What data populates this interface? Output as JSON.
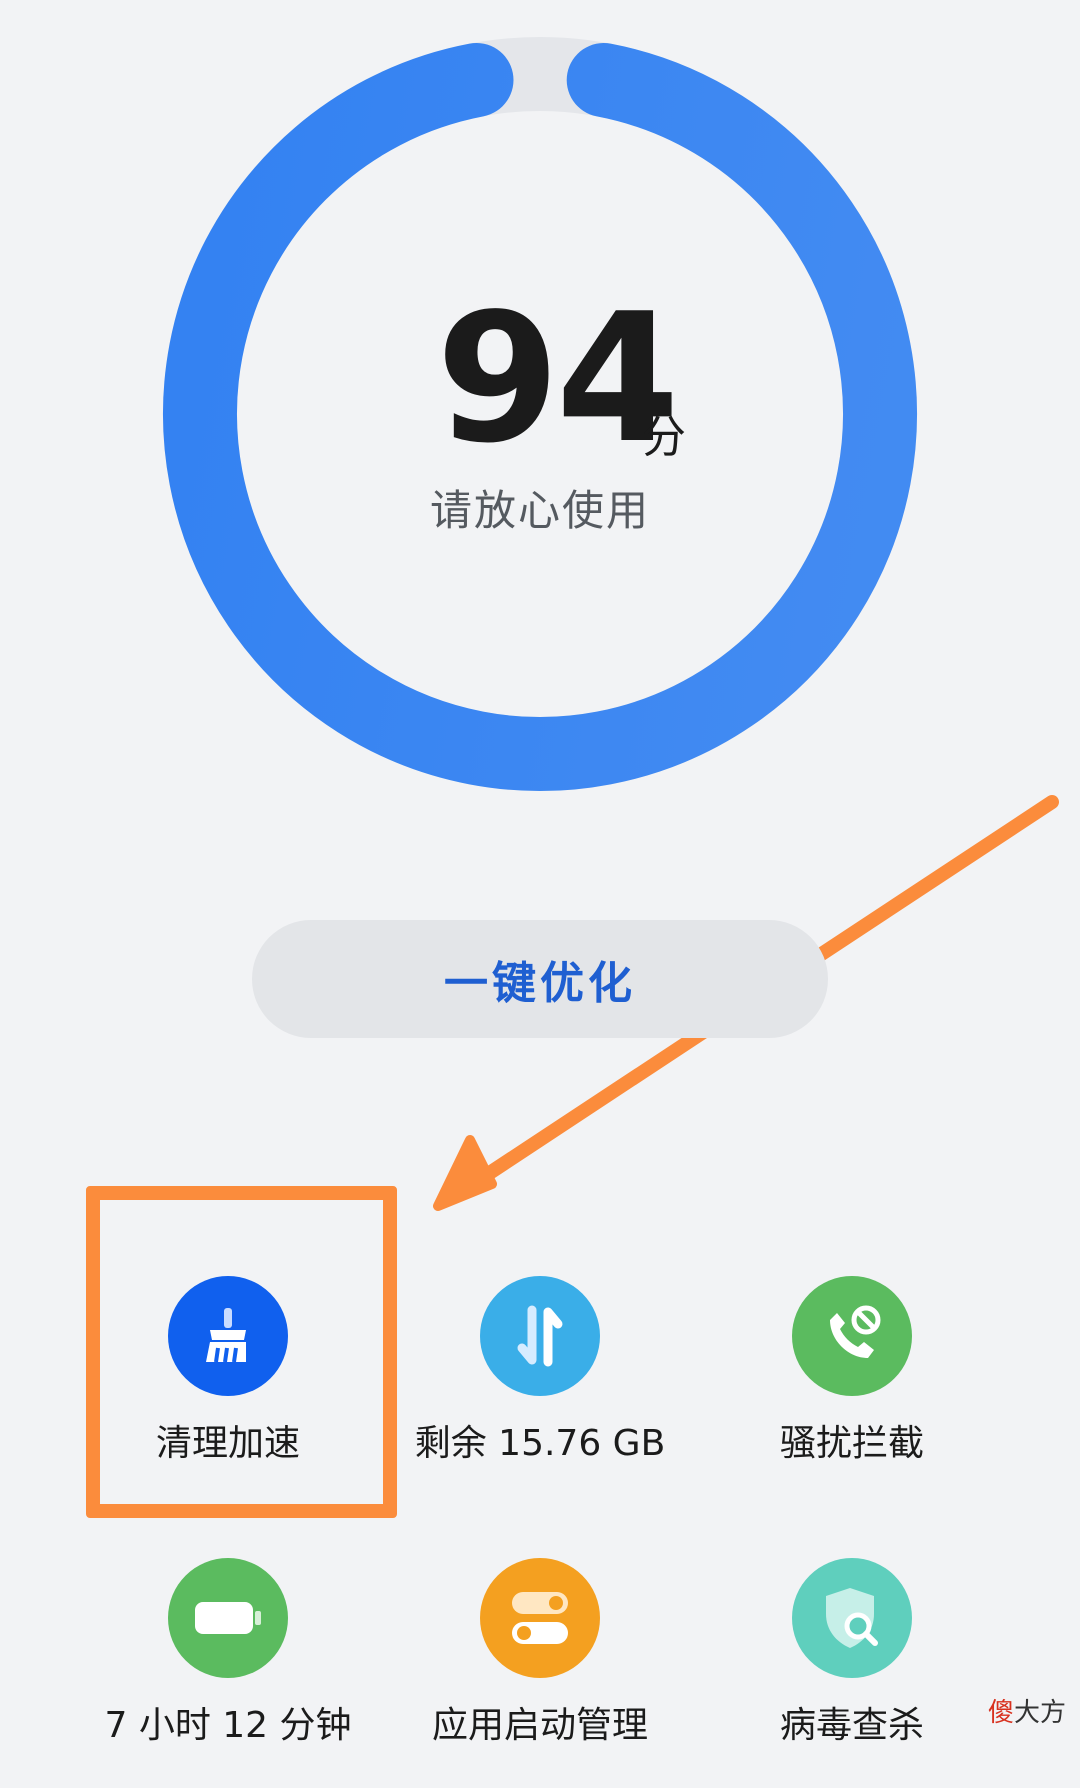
{
  "score": {
    "value": "94",
    "unit": "分",
    "status": "请放心使用"
  },
  "optimize_button": {
    "label": "一键优化"
  },
  "tiles": [
    {
      "label": "清理加速",
      "icon": "broom-icon",
      "color": "#1060ee"
    },
    {
      "label": "剩余 15.76 GB",
      "icon": "storage-arrows-icon",
      "color": "#3aaee8"
    },
    {
      "label": "骚扰拦截",
      "icon": "phone-block-icon",
      "color": "#5bbb5f"
    },
    {
      "label": "7 小时 12 分钟",
      "icon": "battery-icon",
      "color": "#5bbb5f"
    },
    {
      "label": "应用启动管理",
      "icon": "toggle-switches-icon",
      "color": "#f4a020"
    },
    {
      "label": "病毒查杀",
      "icon": "shield-search-icon",
      "color": "#5fcfbd"
    }
  ],
  "annotation": {
    "color": "#fb8c3c"
  },
  "watermark": {
    "red_char": "傻",
    "rest": "大方"
  },
  "colors": {
    "ring_start": "#0a6cf5",
    "ring_end": "#4b8cf0",
    "ring_track": "#e4e6ea",
    "background": "#f2f3f5"
  }
}
